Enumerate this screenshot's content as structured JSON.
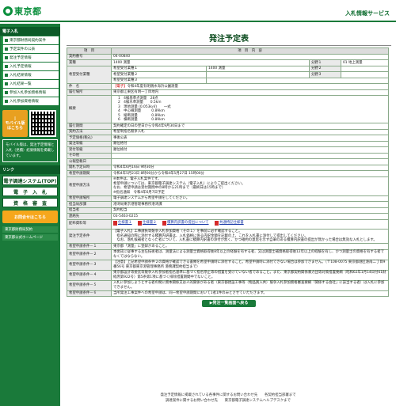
{
  "header": {
    "logo_text": "東京都",
    "right_title": "入札情報サービス"
  },
  "sidebar": {
    "section1": "電子入札",
    "items1": [
      "東京都財務局契約案件",
      "予定案件の公表",
      "発注予定情報",
      "入札予定情報",
      "入札結果情報",
      "入札結果一覧",
      "参加入札参加資格情報",
      "入札参加資格情報"
    ],
    "mobile_label": "モバイル版\nはこちら",
    "mobile_note": "モバイル版は、発注予定情報と入札（見積）結果情報を掲載しています。",
    "section2": "リンク",
    "big_items": [
      "電子調達システム(TOP)",
      "電　子　入　札",
      "資　格　審　査"
    ],
    "orange_label": "お問合せはこちら",
    "links": [
      "東京都財務局契約",
      "東京都公式ホームページ"
    ]
  },
  "main": {
    "title": "発注予定表",
    "col_item": "項　目",
    "col_content": "項　目　内　容",
    "contract_no_label": "契約番号",
    "contract_no": "04-00840",
    "industry_label": "業種",
    "industry": "1400 測量",
    "part_label": "分野１",
    "part_value": "01 地上測量",
    "hope_label": "希望受付業種",
    "hope_rows": [
      {
        "label": "希望受付業種１",
        "value": "1400 測量",
        "part": "分野２"
      },
      {
        "label": "希望受付業種２",
        "value": "",
        "part": "分野３"
      },
      {
        "label": "希望受付業種３",
        "value": "",
        "part": ""
      }
    ],
    "name_label": "件　名",
    "name_tag": "【電子】",
    "name_value": "令和4年度有明親水海浜公園測量",
    "location_label": "履行場所",
    "location": "東京都江東区有明一丁目地内",
    "summary_label": "概要",
    "summary_lines": [
      "1　4級基準点測量　28点",
      "2　4級水準測量　　0.5km",
      "3　現地測量 (0.053k㎡)　　一式",
      "4　中心線測量　　　0.89km",
      "5　縦断測量　　　　0.89km",
      "6　横断測量　　　　0.89km"
    ],
    "period_label": "履行期間",
    "period": "契約確定の日の翌日から令和4年9月30日まで",
    "method_label": "契約方法",
    "method": "希望制指名競争入札",
    "price_label": "予定価格(税込)",
    "price": "事後公表",
    "timing_label": "発注等級",
    "timing": "順位格付",
    "rank_label": "受付等級",
    "rank": "順位格付",
    "other_label": "その他",
    "other": "",
    "publish_label": "公報登載日",
    "publish": "",
    "open_label": "開札予定日時",
    "open": "令和4年6月16日 9時30分",
    "hope_period_label": "希望申請期間",
    "hope_period": "令和4年5月23日 8時00分から令和4年5月27日 15時00分",
    "hope_method_label": "希望申請方法",
    "hope_method": "※本件は、電子入札案件です。\n希望申請については、東京都電子調達システム（電子入札）によりご提出ください。\nなお、希望申請は受付期間中の8時から21時まで（最終日は15時まで）\n※指名通知　令和4年6月7日予定",
    "hope_place_label": "希望申請場所",
    "hope_place": "電子調達システムから希望申請をしてください。",
    "dept_label": "担当局部課",
    "dept": "港湾局東京港管理事務所港湾課",
    "person_label": "担当者",
    "person": "契約担当",
    "contact_label": "連絡先",
    "contact": "03-5463-0215",
    "attach_label": "配布資料等",
    "attachments": [
      "仕様書１",
      "仕様書２",
      "積算内訳書の提出について",
      "共通特記仕様書"
    ],
    "terms_label": "発注予定条件",
    "terms": "【電子入札】工事請負等競争入札参加資格（その１）を事前に必ず確認すること。\n　指名通知の際に添付する積算内訳書は、入札価格に係る内訳金額を記載の上、これを入札書に添付して提出してください。\n　なお、落札候補者となった者について、入札書に積算内訳書の添付が無く、かつ確約の意思を示す自筆のある積算内訳書の提出が無かった場合は無効な入札とします。",
    "req_rows": [
      {
        "label": "希望申請条件－１",
        "value": "東京都「測量」に登録があること。"
      },
      {
        "label": "希望申請条件－２",
        "value": "本委託に従事する主任技術者は、測量法による測量士資格取得後8年以上の経験を有する者、又は測量士補資格取得後12年以上の経験を有し、かつ測量士の資格を有する者でなくてはならない。"
      },
      {
        "label": "希望申請条件－３",
        "value": "【注意】上記希望申請条件２の資格が確認できる書類を希望申請時に添付すること。希望申請時に添付できない場合は参加できません。（〒108-0075 東京都港区港南二丁目9番56号 東京都東京港管理事務所 港務課契約担当まで）"
      },
      {
        "label": "希望申請条件－４",
        "value": "東京都設計等委託等競争入札参加者指名基準に基づく指名停止等の措置を受けていない者であること。また、東京都契約関係暴力団等対策措置要綱（昭和62年1月14日付61財経庶第922号）第5条第1項に基づく排除措置期間中でないこと。"
      },
      {
        "label": "希望申請条件－５",
        "value": "入札に参加しようとする者の間に資本関係又は人的関係がある者（東京都建設工事等（物品買入共）競争入札参加資格審査要綱「関係する会社」に該当する者）は入札に参加できません。"
      },
      {
        "label": "希望申請条件－６",
        "value": "当所発注工事案件への希望申請は、同一希望申請期間において1者1件のみとさせていただきます。"
      }
    ],
    "back_button": "発注一覧画面へ戻る"
  },
  "footer": {
    "line1": "発注予定情報に掲載されている各事件に関するお問い合わせ先　　各契約担当部署まで",
    "line2": "調達案件に関するお問い合わせ先　　東京都電子調達システムヘルプデスクまで"
  }
}
